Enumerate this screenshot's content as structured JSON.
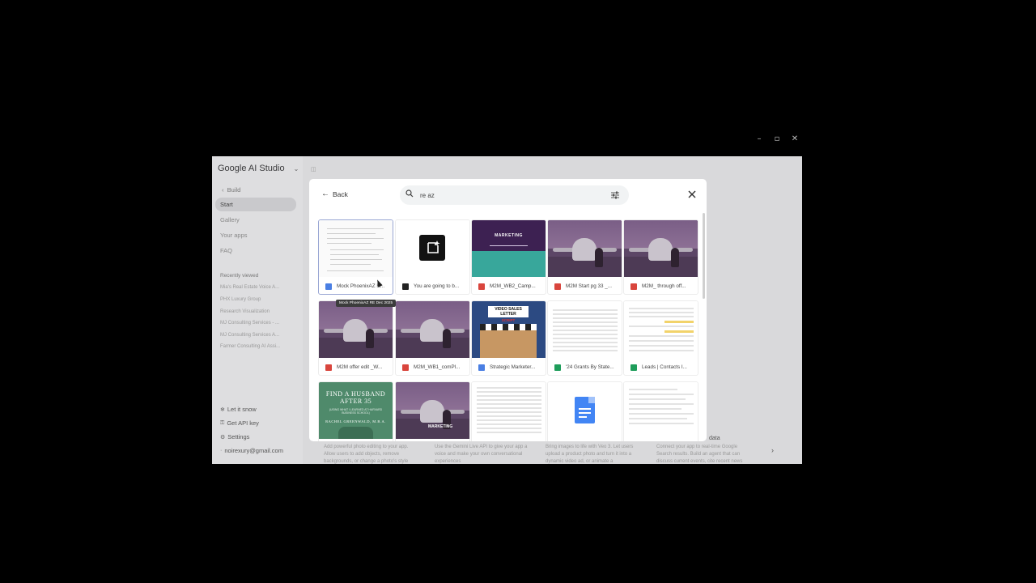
{
  "window_controls": {
    "minimize": "–",
    "restore": "▫",
    "close": "✕"
  },
  "sidebar": {
    "brand": "Google AI Studio",
    "build_label": "Build",
    "nav": [
      {
        "label": "Start",
        "active": true
      },
      {
        "label": "Gallery",
        "active": false
      },
      {
        "label": "Your apps",
        "active": false
      },
      {
        "label": "FAQ",
        "active": false
      }
    ],
    "recent_title": "Recently viewed",
    "recent": [
      "Mia's Real Estate Voice A...",
      "PHX Luxury Group",
      "Research Visualization",
      "MJ Consulting Services - ...",
      "MJ Consulting Services A...",
      "Farmer Consulting AI Assi..."
    ],
    "bottom": [
      {
        "label": "Let it snow",
        "icon": "snowflake-icon"
      },
      {
        "label": "Get API key",
        "icon": "key-icon"
      },
      {
        "label": "Settings",
        "icon": "gear-icon"
      },
      {
        "label": "noirexury@gmail.com",
        "icon": "account-icon"
      }
    ]
  },
  "background_features": [
    {
      "title": "",
      "desc": "Add powerful photo editing to your app. Allow users to add objects, remove backgrounds, or change a photo's style"
    },
    {
      "title": "",
      "desc": "Use the Gemini Live API to give your app a voice and make your own conversational experiences"
    },
    {
      "title": "",
      "desc": "Bring images to life with Veo 3. Let users upload a product photo and turn it into a dynamic video ad, or animate a"
    },
    {
      "title": "data",
      "desc": "Connect your app to real-time Google Search results. Build an agent that can discuss current events, cite recent news"
    }
  ],
  "modal": {
    "back_label": "Back",
    "search_value": "re az",
    "files": [
      {
        "name": "Mock PhoenixAZ R...",
        "type": "doc",
        "thumb": "doc"
      },
      {
        "name": "You are going to b...",
        "type": "gem",
        "thumb": "gem"
      },
      {
        "name": "M2M_WB2_Camp...",
        "type": "pdf",
        "thumb": "marketing",
        "thumb_text": "MARKETING"
      },
      {
        "name": "M2M Start pg 33 _...",
        "type": "pdf",
        "thumb": "jet"
      },
      {
        "name": "M2M_ through off...",
        "type": "pdf",
        "thumb": "jet"
      },
      {
        "name": "M2M offer edit _W...",
        "type": "pdf",
        "thumb": "jet"
      },
      {
        "name": "M2M_WB1_comPl...",
        "type": "pdf",
        "thumb": "jet"
      },
      {
        "name": "Strategic Marketer...",
        "type": "doc",
        "thumb": "vsl",
        "thumb_text": "VIDEO SALES LETTER",
        "thumb_sub": "SCRIPT"
      },
      {
        "name": "'24 Grants By State...",
        "type": "sheet",
        "thumb": "sheet"
      },
      {
        "name": "Leads | Contacts I...",
        "type": "sheet",
        "thumb": "sheet-hl"
      },
      {
        "name": "",
        "type": "doc",
        "thumb": "book",
        "thumb_text": "FIND A HUSBAND AFTER 35",
        "thumb_sub": "(USING WHAT I LEARNED AT HARVARD BUSINESS SCHOOL)",
        "thumb_author": "RACHEL GREENWALD, M.B.A."
      },
      {
        "name": "",
        "type": "pdf",
        "thumb": "jet-mkt",
        "thumb_text": "MARKETING"
      },
      {
        "name": "",
        "type": "sheet",
        "thumb": "sheet"
      },
      {
        "name": "",
        "type": "doc",
        "thumb": "gdoc"
      },
      {
        "name": "",
        "type": "doc",
        "thumb": "sheet"
      }
    ],
    "tooltip": "Mock PhoenixAZ RE Dec 2025"
  },
  "colors": {
    "doc": "#4a7fe3",
    "pdf": "#d9453d",
    "sheet": "#1e9d5a",
    "overlay": "#d9d9db"
  }
}
